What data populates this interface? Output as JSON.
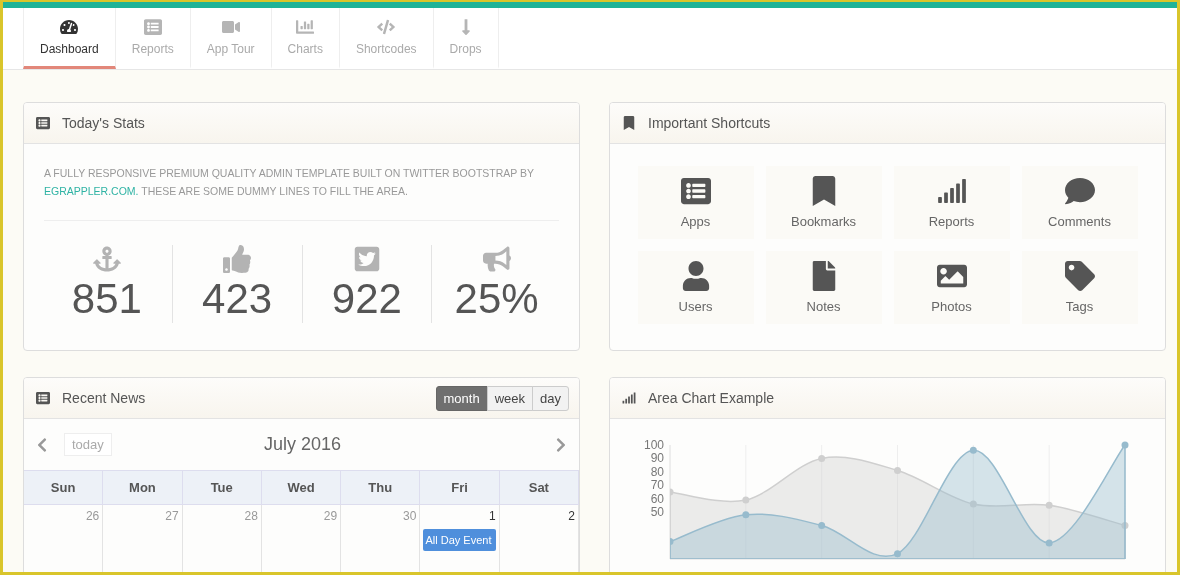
{
  "nav": {
    "tabs": [
      {
        "label": "Dashboard",
        "selected": true
      },
      {
        "label": "Reports",
        "selected": false
      },
      {
        "label": "App Tour",
        "selected": false
      },
      {
        "label": "Charts",
        "selected": false
      },
      {
        "label": "Shortcodes",
        "selected": false
      },
      {
        "label": "Drops",
        "selected": false
      }
    ]
  },
  "stats_panel": {
    "title": "Today's Stats",
    "intro": {
      "before": "A FULLY RESPONSIVE PREMIUM QUALITY ADMIN TEMPLATE BUILT ON TWITTER BOOTSTRAP BY",
      "link": "EGRAPPLER.COM.",
      "after": "THESE ARE SOME DUMMY LINES TO FILL THE AREA."
    },
    "stats": [
      {
        "value": "851"
      },
      {
        "value": "423"
      },
      {
        "value": "922"
      },
      {
        "value": "25%"
      }
    ]
  },
  "shortcuts_panel": {
    "title": "Important Shortcuts",
    "items": [
      {
        "label": "Apps"
      },
      {
        "label": "Bookmarks"
      },
      {
        "label": "Reports"
      },
      {
        "label": "Comments"
      },
      {
        "label": "Users"
      },
      {
        "label": "Notes"
      },
      {
        "label": "Photos"
      },
      {
        "label": "Tags"
      }
    ]
  },
  "news_panel": {
    "title": "Recent News",
    "views": [
      {
        "label": "month",
        "selected": true
      },
      {
        "label": "week",
        "selected": false
      },
      {
        "label": "day",
        "selected": false
      }
    ],
    "calendar": {
      "today_button": "today",
      "month": "July 2016",
      "weekdays": [
        "Sun",
        "Mon",
        "Tue",
        "Wed",
        "Thu",
        "Fri",
        "Sat"
      ],
      "days": [
        {
          "date": "26",
          "other_month": true
        },
        {
          "date": "27",
          "other_month": true
        },
        {
          "date": "28",
          "other_month": true
        },
        {
          "date": "29",
          "other_month": true
        },
        {
          "date": "30",
          "other_month": true
        },
        {
          "date": "1",
          "other_month": false,
          "events": [
            "All Day Event"
          ]
        },
        {
          "date": "2",
          "other_month": false
        }
      ]
    }
  },
  "chart_panel": {
    "title": "Area Chart Example",
    "chart_data": {
      "type": "area",
      "categories": [
        null,
        null,
        null,
        null,
        null,
        null,
        null
      ],
      "grid": true,
      "ylim": [
        15,
        100
      ],
      "yticks": [
        50,
        60,
        70,
        80,
        90,
        100
      ],
      "series": [
        {
          "color": "#cfcfcf",
          "values": [
            65,
            59,
            90,
            81,
            56,
            55,
            40
          ]
        },
        {
          "color": "#97bbcd",
          "values": [
            28,
            48,
            40,
            19,
            96,
            27,
            100
          ]
        }
      ]
    }
  }
}
